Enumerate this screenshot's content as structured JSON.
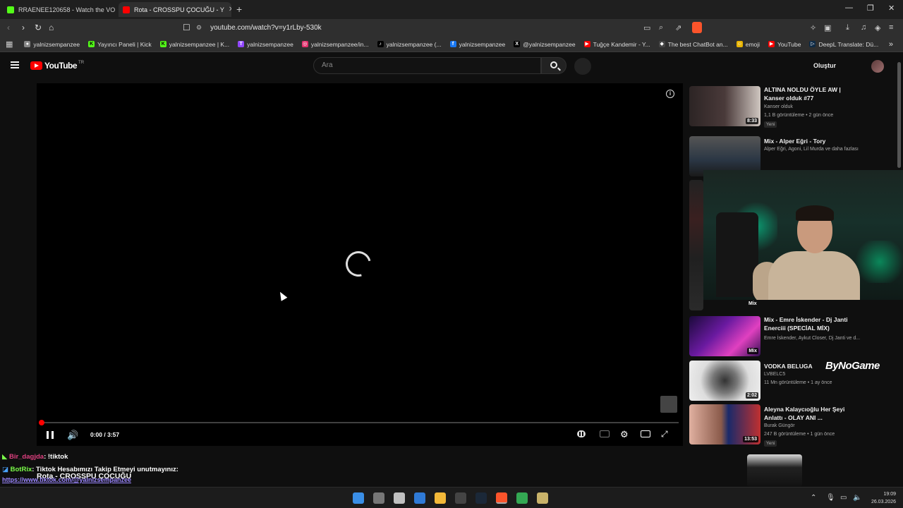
{
  "browser": {
    "tabs": [
      {
        "label": "RRAENEE120658 - Watch the VOD o",
        "favicon_color": "#53fc18"
      },
      {
        "label": "Rota - CROSSPU ÇOCUĞU - Y",
        "favicon_color": "#ff0000",
        "active": true
      }
    ],
    "new_tab_label": "+",
    "window_controls": {
      "minimize": "—",
      "maximize": "❐",
      "close": "✕"
    },
    "nav": {
      "back": "‹",
      "forward": "›",
      "reload": "↻",
      "home": "⌂",
      "bookmark": "☐"
    },
    "url": "youtube.com/watch?v=y1rLby-530k",
    "bookmarks": [
      {
        "label": "yalnizsempanzee",
        "icon_color": "#888888",
        "icon": "●"
      },
      {
        "label": "Yayıncı Paneli | Kick",
        "icon_color": "#53fc18",
        "icon": "K"
      },
      {
        "label": "yalnizsempanzee | K...",
        "icon_color": "#53fc18",
        "icon": "K"
      },
      {
        "label": "yalnizsempanzee",
        "icon_color": "#9146ff",
        "icon": "T"
      },
      {
        "label": "yalnizsempanzee/in...",
        "icon_color": "#e1306c",
        "icon": "◎"
      },
      {
        "label": "yalnizsempanzee (...",
        "icon_color": "#000000",
        "icon": "♪"
      },
      {
        "label": "yalnizsempanzee",
        "icon_color": "#1877f2",
        "icon": "f"
      },
      {
        "label": "@yalnizsempanzee",
        "icon_color": "#000000",
        "icon": "X"
      },
      {
        "label": "Tuğçe Kandemir - Y...",
        "icon_color": "#ff0000",
        "icon": "▶"
      },
      {
        "label": "The best ChatBot an...",
        "icon_color": "#444444",
        "icon": "◆"
      },
      {
        "label": "emoji",
        "icon_color": "#e8b400",
        "icon": "☺"
      },
      {
        "label": "YouTube",
        "icon_color": "#ff0000",
        "icon": "▶"
      },
      {
        "label": "DeepL Translate: Dü...",
        "icon_color": "#0f2b46",
        "icon": "▷"
      }
    ]
  },
  "youtube": {
    "logo_text": "YouTube",
    "logo_country": "TR",
    "search_placeholder": "Ara",
    "create_label": "Oluştur"
  },
  "player": {
    "time_label": "0:00 / 3:57",
    "progress_fraction": 0.0,
    "loading": true
  },
  "recommendations": [
    {
      "title": "ALTINA NOLDU ÖYLE AW | Kanser olduk #77",
      "channel": "Kanser olduk",
      "meta": "1,1 B görüntüleme • 2 gün önce",
      "badge": "Yeni",
      "duration": "8:33",
      "thumb_color": "#3a3030"
    },
    {
      "title": "Mix - Alper Eğri - Tory",
      "channel": "Alper Eğri, Agoni, Lil Murda ve daha fazlası",
      "meta": "",
      "badge": "",
      "duration": "",
      "thumb_color": "#2a2e36"
    },
    {
      "title": "Mix - Emre İskender - Dj Janti Enerciii (SPECİAL MİX)",
      "channel": "Emre İskender, Aykut Closer, Dj Janti ve d...",
      "meta": "",
      "badge": "",
      "duration": "Mix",
      "thumb_color": "#3a1a5a"
    },
    {
      "title": "VODKA BELUGA",
      "channel": "LVBELC5",
      "meta": "11 Mn görüntüleme • 1 ay önce",
      "badge": "",
      "duration": "2:02",
      "thumb_color": "#d8d8d8"
    },
    {
      "title": "Aleyna Kalaycıoğlu Her Şeyi Anlattı - OLAY ANI ...",
      "channel": "Burak Güngör",
      "meta": "247 B görüntüleme • 1 gün önce",
      "badge": "Yeni",
      "duration": "13:53",
      "thumb_color": "#8a6a5a"
    }
  ],
  "overlay": {
    "mix_label": "Mix",
    "sponsor": "ByNoGame",
    "chat": [
      {
        "user": "Bir_dagjda",
        "message": ": !tiktok"
      },
      {
        "user": "BotRix",
        "message": ": Tiktok Hesabımızı Takip Etmeyi unutmayınız:"
      }
    ],
    "song_title": "Rota - CROSSPU ÇOCUĞU",
    "link": "https://www.tiktok.com/@yalnizsempanzee"
  },
  "taskbar": {
    "time": "19:09",
    "date": "26.03.2026",
    "icons": [
      {
        "name": "windows-start",
        "color": "#3a8ee6"
      },
      {
        "name": "task-view",
        "color": "#777777"
      },
      {
        "name": "app-notepad",
        "color": "#c0c0c0"
      },
      {
        "name": "app-photos",
        "color": "#2f7ad6"
      },
      {
        "name": "file-explorer",
        "color": "#f3b939"
      },
      {
        "name": "app-obs",
        "color": "#444444"
      },
      {
        "name": "app-steam",
        "color": "#1b2838"
      },
      {
        "name": "brave-browser",
        "color": "#fb542b"
      },
      {
        "name": "chrome-browser",
        "color": "#34a853"
      },
      {
        "name": "app-generic",
        "color": "#c9b36a"
      }
    ]
  }
}
